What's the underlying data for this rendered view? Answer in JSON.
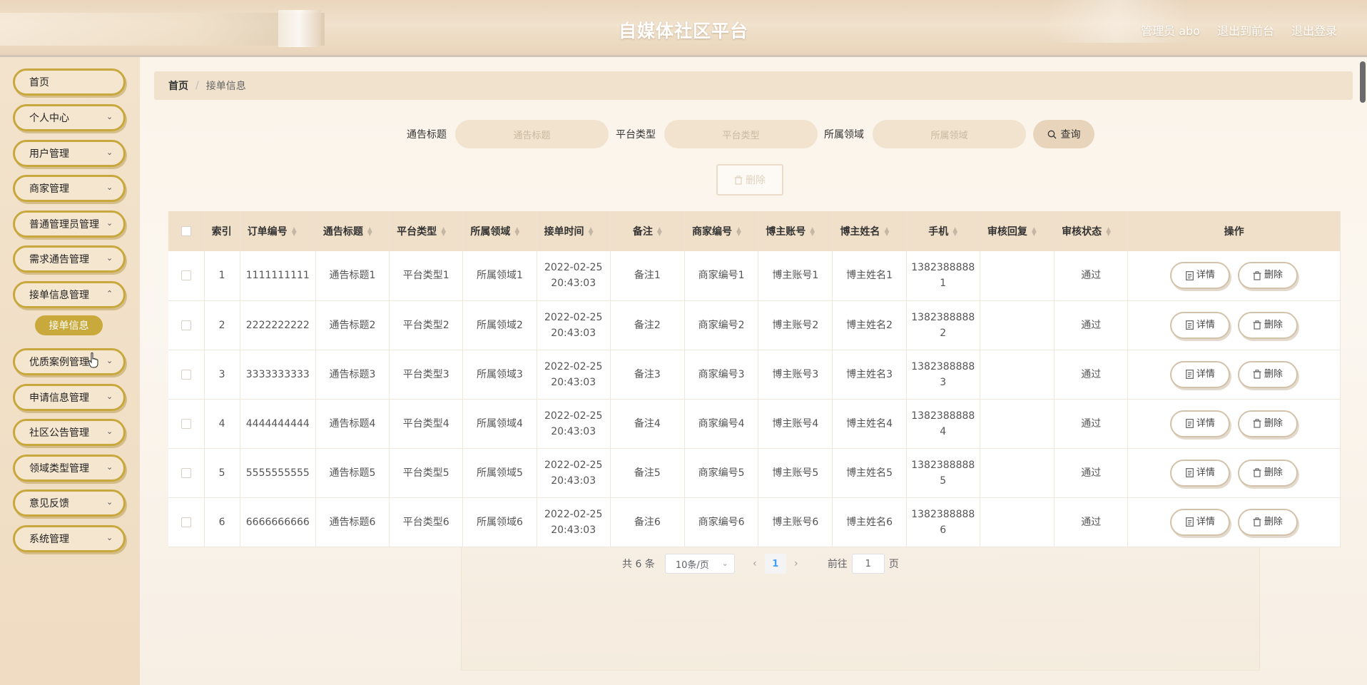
{
  "header": {
    "title": "自媒体社区平台",
    "admin_label": "管理员 abo",
    "to_front": "退出到前台",
    "logout": "退出登录"
  },
  "sidebar": {
    "items": [
      {
        "label": "首页"
      },
      {
        "label": "个人中心"
      },
      {
        "label": "用户管理"
      },
      {
        "label": "商家管理"
      },
      {
        "label": "普通管理员管理"
      },
      {
        "label": "需求通告管理"
      },
      {
        "label": "接单信息管理"
      },
      {
        "label": "优质案例管理"
      },
      {
        "label": "申请信息管理"
      },
      {
        "label": "社区公告管理"
      },
      {
        "label": "领域类型管理"
      },
      {
        "label": "意见反馈"
      },
      {
        "label": "系统管理"
      }
    ],
    "active_sub": "接单信息"
  },
  "breadcrumb": {
    "home": "首页",
    "separator": "/",
    "current": "接单信息"
  },
  "search": {
    "label1": "通告标题",
    "placeholder1": "通告标题",
    "label2": "平台类型",
    "placeholder2": "平台类型",
    "label3": "所属领域",
    "placeholder3": "所属领域",
    "button": "查询"
  },
  "batch_delete": "删除",
  "table": {
    "headers": [
      "索引",
      "订单编号",
      "通告标题",
      "平台类型",
      "所属领域",
      "接单时间",
      "备注",
      "商家编号",
      "博主账号",
      "博主姓名",
      "手机",
      "审核回复",
      "审核状态",
      "操作"
    ],
    "rows": [
      {
        "idx": "1",
        "order": "1111111111",
        "title": "通告标题1",
        "platform": "平台类型1",
        "field": "所属领域1",
        "date": "2022-02-25",
        "time": "20:43:03",
        "note": "备注1",
        "merchant": "商家编号1",
        "account": "博主账号1",
        "name": "博主姓名1",
        "phone1": "1382388888",
        "phone2": "1",
        "reply": "",
        "status": "通过"
      },
      {
        "idx": "2",
        "order": "2222222222",
        "title": "通告标题2",
        "platform": "平台类型2",
        "field": "所属领域2",
        "date": "2022-02-25",
        "time": "20:43:03",
        "note": "备注2",
        "merchant": "商家编号2",
        "account": "博主账号2",
        "name": "博主姓名2",
        "phone1": "1382388888",
        "phone2": "2",
        "reply": "",
        "status": "通过"
      },
      {
        "idx": "3",
        "order": "3333333333",
        "title": "通告标题3",
        "platform": "平台类型3",
        "field": "所属领域3",
        "date": "2022-02-25",
        "time": "20:43:03",
        "note": "备注3",
        "merchant": "商家编号3",
        "account": "博主账号3",
        "name": "博主姓名3",
        "phone1": "1382388888",
        "phone2": "3",
        "reply": "",
        "status": "通过"
      },
      {
        "idx": "4",
        "order": "4444444444",
        "title": "通告标题4",
        "platform": "平台类型4",
        "field": "所属领域4",
        "date": "2022-02-25",
        "time": "20:43:03",
        "note": "备注4",
        "merchant": "商家编号4",
        "account": "博主账号4",
        "name": "博主姓名4",
        "phone1": "1382388888",
        "phone2": "4",
        "reply": "",
        "status": "通过"
      },
      {
        "idx": "5",
        "order": "5555555555",
        "title": "通告标题5",
        "platform": "平台类型5",
        "field": "所属领域5",
        "date": "2022-02-25",
        "time": "20:43:03",
        "note": "备注5",
        "merchant": "商家编号5",
        "account": "博主账号5",
        "name": "博主姓名5",
        "phone1": "1382388888",
        "phone2": "5",
        "reply": "",
        "status": "通过"
      },
      {
        "idx": "6",
        "order": "6666666666",
        "title": "通告标题6",
        "platform": "平台类型6",
        "field": "所属领域6",
        "date": "2022-02-25",
        "time": "20:43:03",
        "note": "备注6",
        "merchant": "商家编号6",
        "account": "博主账号6",
        "name": "博主姓名6",
        "phone1": "1382388888",
        "phone2": "6",
        "reply": "",
        "status": "通过"
      }
    ],
    "detail_btn": "详情",
    "delete_btn": "删除"
  },
  "pagination": {
    "total": "共 6 条",
    "page_size": "10条/页",
    "current_page": "1",
    "goto_prefix": "前往",
    "goto_value": "1",
    "goto_suffix": "页"
  }
}
